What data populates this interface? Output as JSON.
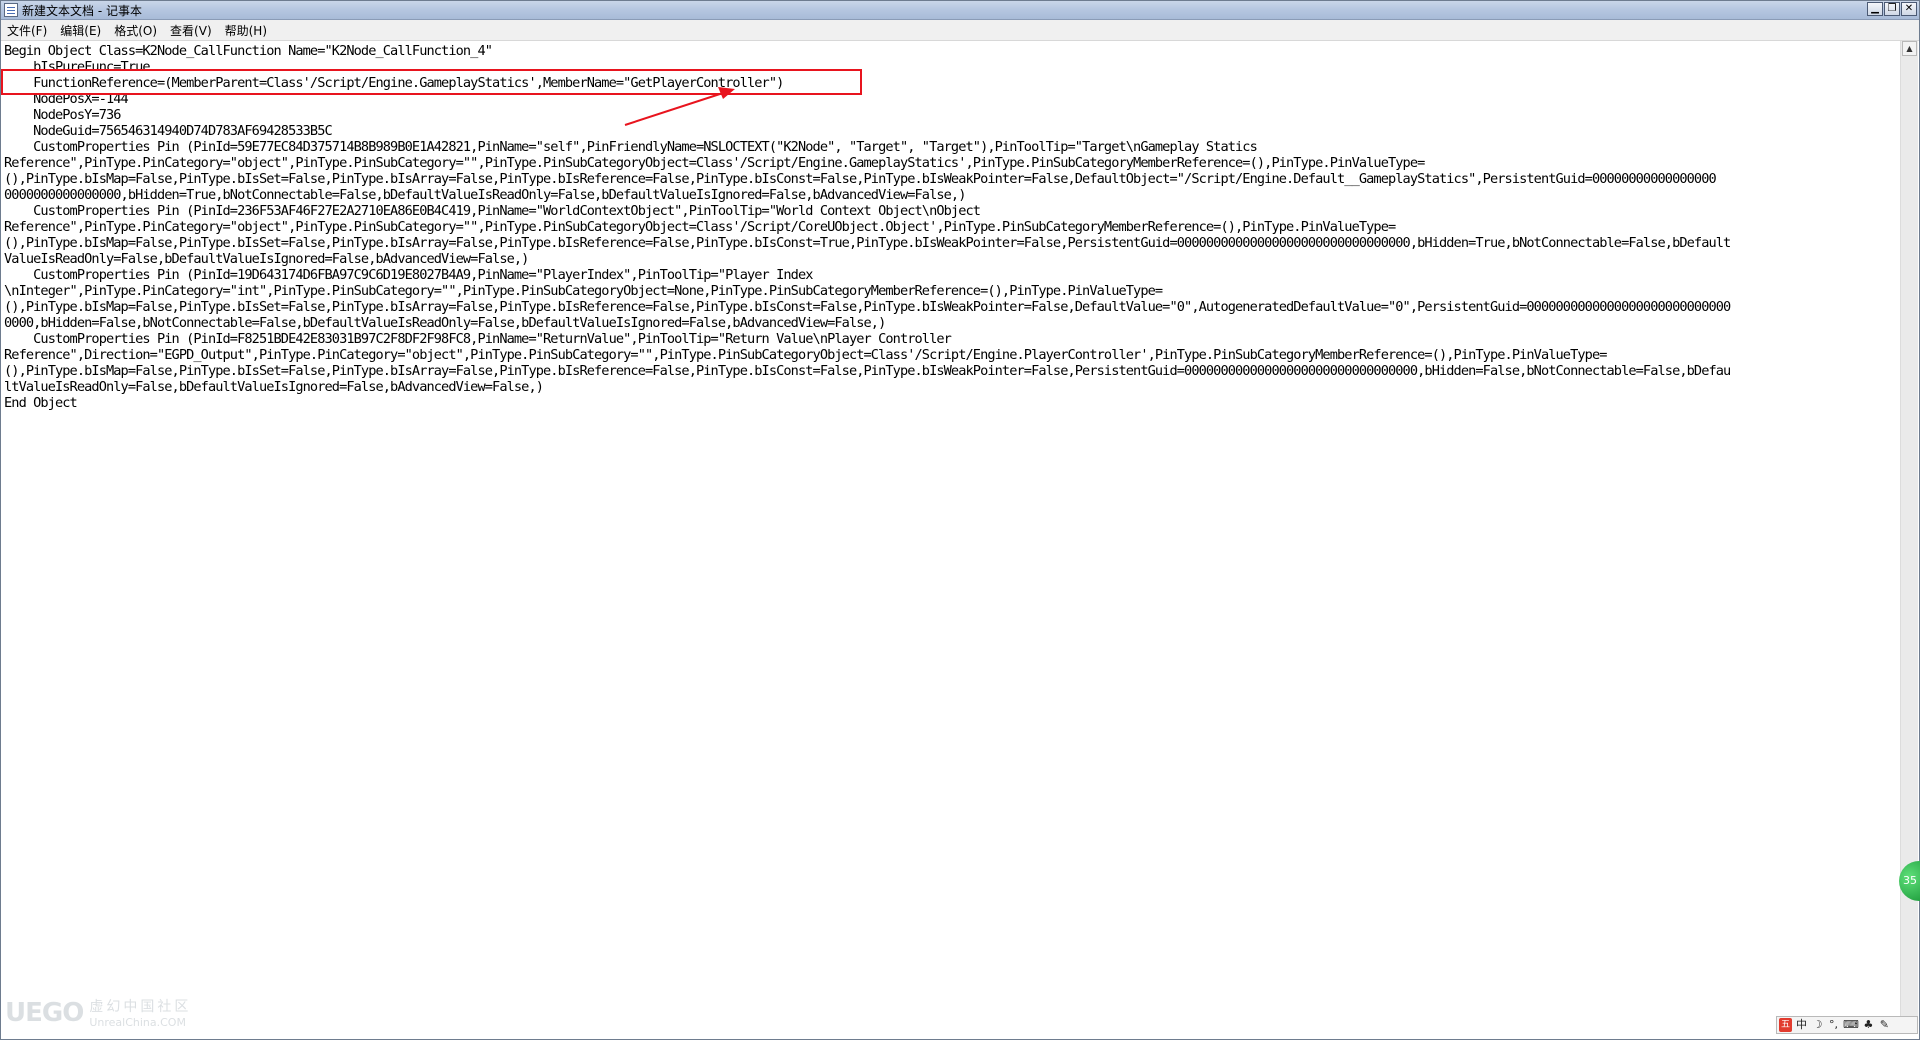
{
  "window": {
    "title": "新建文本文档 - 记事本",
    "controls": [
      "minimize",
      "maximize",
      "close"
    ]
  },
  "menu": [
    "文件(F)",
    "编辑(E)",
    "格式(O)",
    "查看(V)",
    "帮助(H)"
  ],
  "editor": {
    "lines": [
      "Begin Object Class=K2Node_CallFunction Name=\"K2Node_CallFunction_4\"",
      "    bIsPureFunc=True",
      "    FunctionReference=(MemberParent=Class'/Script/Engine.GameplayStatics',MemberName=\"GetPlayerController\")",
      "    NodePosX=-144",
      "    NodePosY=736",
      "    NodeGuid=756546314940D74D783AF69428533B5C",
      "    CustomProperties Pin (PinId=59E77EC84D375714B8B989B0E1A42821,PinName=\"self\",PinFriendlyName=NSLOCTEXT(\"K2Node\", \"Target\", \"Target\"),PinToolTip=\"Target\\nGameplay Statics",
      "Reference\",PinType.PinCategory=\"object\",PinType.PinSubCategory=\"\",PinType.PinSubCategoryObject=Class'/Script/Engine.GameplayStatics',PinType.PinSubCategoryMemberReference=(),PinType.PinValueType=",
      "(),PinType.bIsMap=False,PinType.bIsSet=False,PinType.bIsArray=False,PinType.bIsReference=False,PinType.bIsConst=False,PinType.bIsWeakPointer=False,DefaultObject=\"/Script/Engine.Default__GameplayStatics\",PersistentGuid=00000000000000000",
      "0000000000000000,bHidden=True,bNotConnectable=False,bDefaultValueIsReadOnly=False,bDefaultValueIsIgnored=False,bAdvancedView=False,)",
      "    CustomProperties Pin (PinId=236F53AF46F27E2A2710EA86E0B4C419,PinName=\"WorldContextObject\",PinToolTip=\"World Context Object\\nObject",
      "Reference\",PinType.PinCategory=\"object\",PinType.PinSubCategory=\"\",PinType.PinSubCategoryObject=Class'/Script/CoreUObject.Object',PinType.PinSubCategoryMemberReference=(),PinType.PinValueType=",
      "(),PinType.bIsMap=False,PinType.bIsSet=False,PinType.bIsArray=False,PinType.bIsReference=False,PinType.bIsConst=True,PinType.bIsWeakPointer=False,PersistentGuid=00000000000000000000000000000000,bHidden=True,bNotConnectable=False,bDefault",
      "ValueIsReadOnly=False,bDefaultValueIsIgnored=False,bAdvancedView=False,)",
      "    CustomProperties Pin (PinId=19D643174D6FBA97C9C6D19E8027B4A9,PinName=\"PlayerIndex\",PinToolTip=\"Player Index",
      "\\nInteger\",PinType.PinCategory=\"int\",PinType.PinSubCategory=\"\",PinType.PinSubCategoryObject=None,PinType.PinSubCategoryMemberReference=(),PinType.PinValueType=",
      "(),PinType.bIsMap=False,PinType.bIsSet=False,PinType.bIsArray=False,PinType.bIsReference=False,PinType.bIsConst=False,PinType.bIsWeakPointer=False,DefaultValue=\"0\",AutogeneratedDefaultValue=\"0\",PersistentGuid=0000000000000000000000000000",
      "0000,bHidden=False,bNotConnectable=False,bDefaultValueIsReadOnly=False,bDefaultValueIsIgnored=False,bAdvancedView=False,)",
      "    CustomProperties Pin (PinId=F8251BDE42E83031B97C2F8DF2F98FC8,PinName=\"ReturnValue\",PinToolTip=\"Return Value\\nPlayer Controller",
      "Reference\",Direction=\"EGPD_Output\",PinType.PinCategory=\"object\",PinType.PinSubCategory=\"\",PinType.PinSubCategoryObject=Class'/Script/Engine.PlayerController',PinType.PinSubCategoryMemberReference=(),PinType.PinValueType=",
      "(),PinType.bIsMap=False,PinType.bIsSet=False,PinType.bIsArray=False,PinType.bIsReference=False,PinType.bIsConst=False,PinType.bIsWeakPointer=False,PersistentGuid=00000000000000000000000000000000,bHidden=False,bNotConnectable=False,bDefau",
      "ltValueIsReadOnly=False,bDefaultValueIsIgnored=False,bAdvancedView=False,)",
      "End Object"
    ]
  },
  "watermark": {
    "logo": "UEGO",
    "cn": "虚幻中国社区",
    "url": "UnrealChina.COM"
  },
  "bubble": {
    "value": "35"
  },
  "ime": {
    "items": [
      "五",
      "中",
      "☽",
      "°,",
      "⌨",
      "♣",
      "✎"
    ]
  },
  "colors": {
    "annotation": "#e8141e"
  }
}
